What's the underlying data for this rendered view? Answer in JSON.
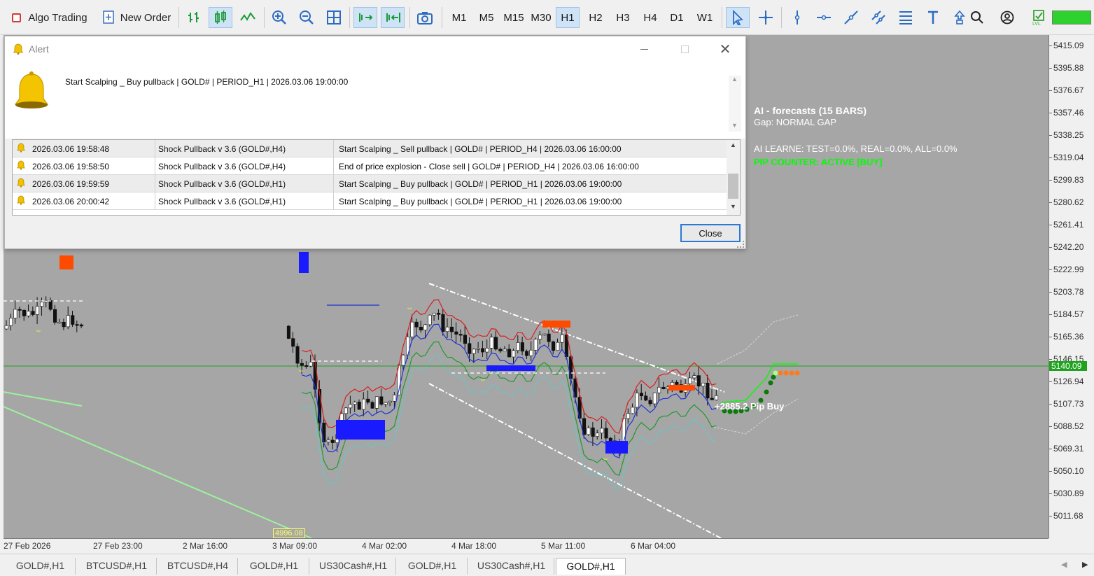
{
  "toolbar": {
    "algo_trading": "Algo Trading",
    "new_order": "New Order",
    "timeframes": [
      "M1",
      "M5",
      "M15",
      "M30",
      "H1",
      "H2",
      "H3",
      "H4",
      "D1",
      "W1"
    ],
    "selected_timeframe": "H1"
  },
  "alert": {
    "title": "Alert",
    "message": "Start Scalping _ Buy pullback | GOLD# | PERIOD_H1 | 2026.03.06 19:00:00",
    "rows": [
      {
        "time": "2026.03.06 19:58:48",
        "source": "Shock Pullback v 3.6 (GOLD#,H4)",
        "message": "Start Scalping _ Sell pullback | GOLD# | PERIOD_H4 | 2026.03.06 16:00:00"
      },
      {
        "time": "2026.03.06 19:58:50",
        "source": "Shock Pullback v 3.6 (GOLD#,H4)",
        "message": "End of price explosion - Close sell | GOLD# | PERIOD_H4 | 2026.03.06 16:00:00"
      },
      {
        "time": "2026.03.06 19:59:59",
        "source": "Shock Pullback v 3.6 (GOLD#,H1)",
        "message": "Start Scalping _ Buy pullback | GOLD# | PERIOD_H1 | 2026.03.06 19:00:00"
      },
      {
        "time": "2026.03.06 20:00:42",
        "source": "Shock Pullback v 3.6 (GOLD#,H1)",
        "message": "Start Scalping _ Buy pullback | GOLD# | PERIOD_H1 | 2026.03.06 19:00:00"
      }
    ],
    "close_label": "Close"
  },
  "chart_overlay": {
    "ai_title": "AI - forecasts (15 BARS)",
    "gap": "Gap: NORMAL GAP",
    "ai_learne": "AI LEARNE: TEST=0.0%, REAL=0.0%, ALL=0.0%",
    "pip_counter": "PIP COUNTER: ACTIVE [BUY]",
    "pip_buy": "+2885.2 Pip Buy",
    "low_label": "4996.08"
  },
  "price_axis": {
    "labels": [
      "5415.09",
      "5395.88",
      "5376.67",
      "5357.46",
      "5338.25",
      "5319.04",
      "5299.83",
      "5280.62",
      "5261.41",
      "5242.20",
      "5222.99",
      "5203.78",
      "5184.57",
      "5165.36",
      "5146.15",
      "5126.94",
      "5107.73",
      "5088.52",
      "5069.31",
      "5050.10",
      "5030.89",
      "5011.68"
    ],
    "current_price": "5140.09"
  },
  "time_axis": {
    "labels": [
      "27 Feb 2026",
      "27 Feb 23:00",
      "2 Mar 16:00",
      "3 Mar 09:00",
      "4 Mar 02:00",
      "4 Mar 18:00",
      "5 Mar 11:00",
      "6 Mar 04:00"
    ]
  },
  "tabs": [
    "GOLD#,H1",
    "BTCUSD#,H1",
    "BTCUSD#,H4",
    "GOLD#,H1",
    "US30Cash#,H1",
    "GOLD#,H1",
    "US30Cash#,H1",
    "GOLD#,H1"
  ],
  "active_tab_index": 7,
  "colors": {
    "chart_bg": "#a6a6a6",
    "accent": "#2b78d6",
    "current_price": "#1fa31f",
    "pip_green": "#00ff00"
  }
}
